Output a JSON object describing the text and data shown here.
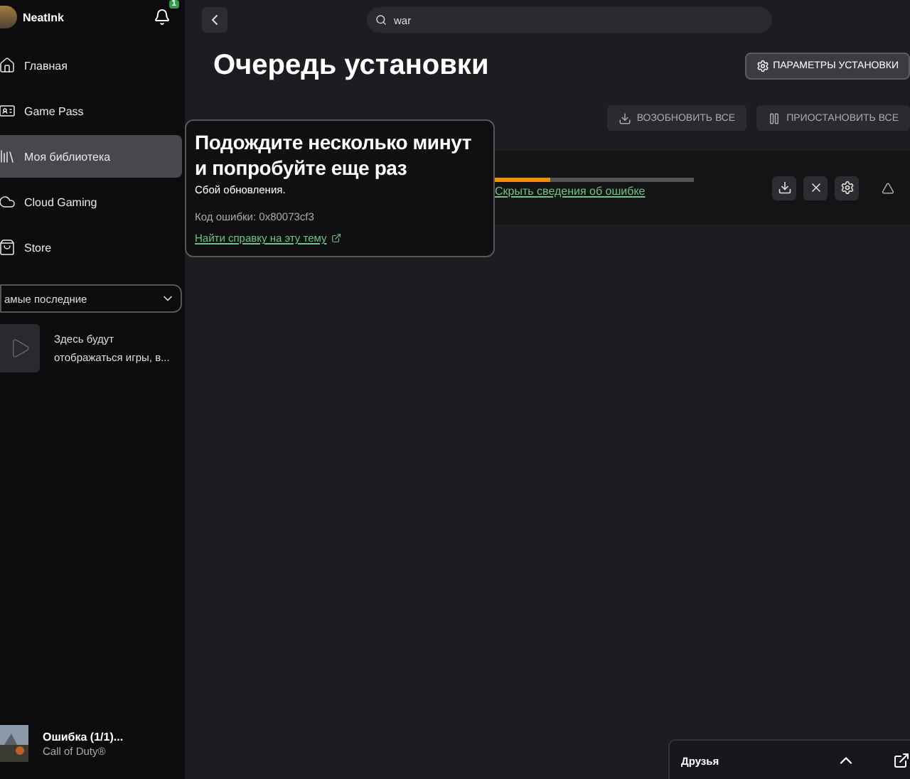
{
  "profile": {
    "name": "NeatInk",
    "notifications": "1"
  },
  "nav": [
    {
      "label": "Главная",
      "selected": false
    },
    {
      "label": "Game Pass",
      "selected": false
    },
    {
      "label": "Моя библиотека",
      "selected": true
    },
    {
      "label": "Cloud Gaming",
      "selected": false
    },
    {
      "label": "Store",
      "selected": false
    }
  ],
  "sort_dropdown": {
    "value": "амые последние"
  },
  "recent_placeholder": "Здесь будут отображаться игры, в...",
  "download_status": {
    "title": "Ошибка (1/1)...",
    "game": "Call of Duty®"
  },
  "search": {
    "value": "war"
  },
  "page_title": "Очередь установки",
  "settings_button": "ПАРАМЕТРЫ УСТАНОВКИ",
  "queue_actions": [
    {
      "label": "ВОЗОБНОВИТЬ ВСЕ"
    },
    {
      "label": "ПРИОСТАНОВИТЬ ВСЕ"
    }
  ],
  "queue_item": {
    "level": 0.28,
    "link": "Скрыть сведения об ошибке",
    "expanded": true
  },
  "error_popup": {
    "title": "Подождите несколько минут и попробуйте еще раз",
    "message": "Сбой обновления.",
    "code": "Код ошибки: 0x80073cf3",
    "help_link": "Найти справку на эту тему"
  },
  "friends_panel": {
    "title": "Друзья"
  }
}
